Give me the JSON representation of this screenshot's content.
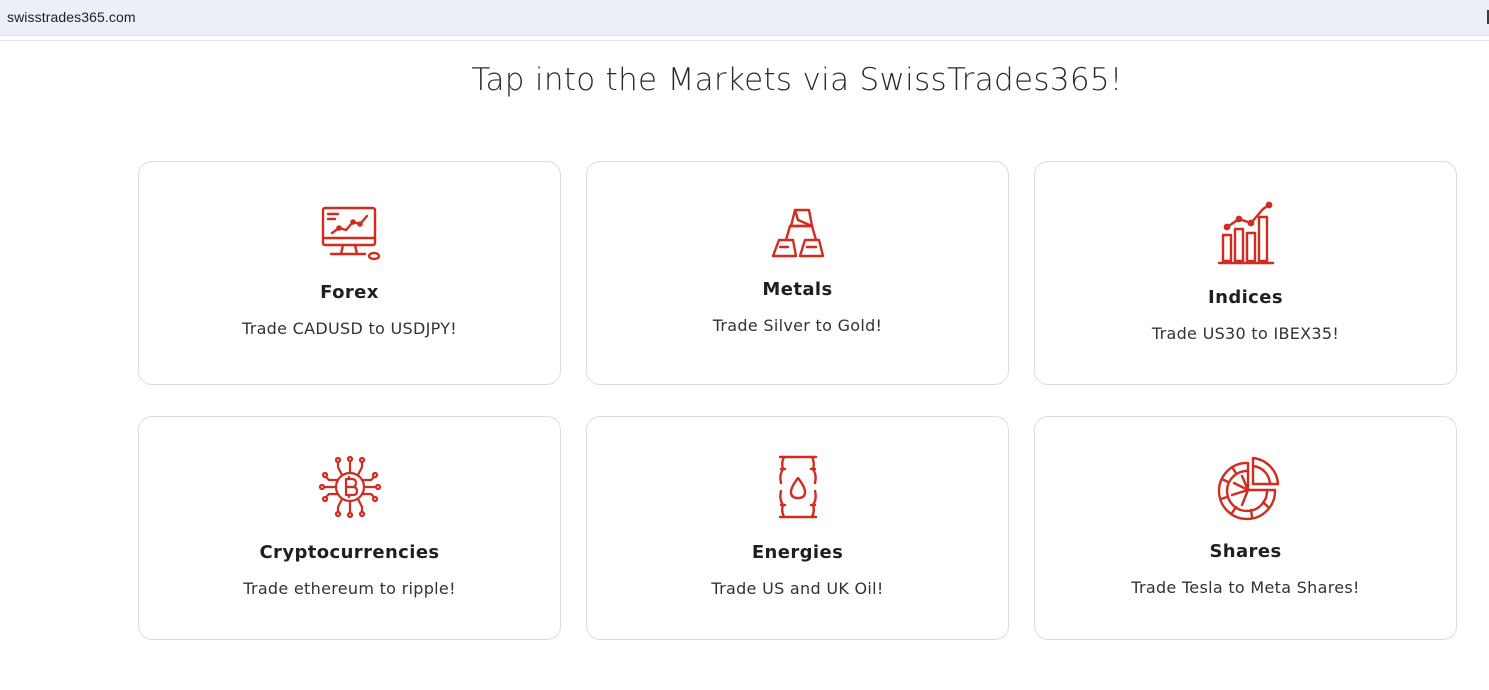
{
  "browser": {
    "url": "swisstrades365.com"
  },
  "page": {
    "heading": "Tap into the Markets via SwissTrades365!",
    "accent_color": "#d22b1f"
  },
  "markets": [
    {
      "icon": "computer-chart-icon",
      "title": "Forex",
      "description": "Trade CADUSD to USDJPY!"
    },
    {
      "icon": "gold-bars-icon",
      "title": "Metals",
      "description": "Trade Silver to Gold!"
    },
    {
      "icon": "bar-chart-icon",
      "title": "Indices",
      "description": "Trade US30 to IBEX35!"
    },
    {
      "icon": "bitcoin-circuit-icon",
      "title": "Cryptocurrencies",
      "description": "Trade ethereum to ripple!"
    },
    {
      "icon": "oil-barrel-icon",
      "title": "Energies",
      "description": "Trade US and UK Oil!"
    },
    {
      "icon": "pie-chart-icon",
      "title": "Shares",
      "description": "Trade Tesla to Meta Shares!"
    }
  ]
}
